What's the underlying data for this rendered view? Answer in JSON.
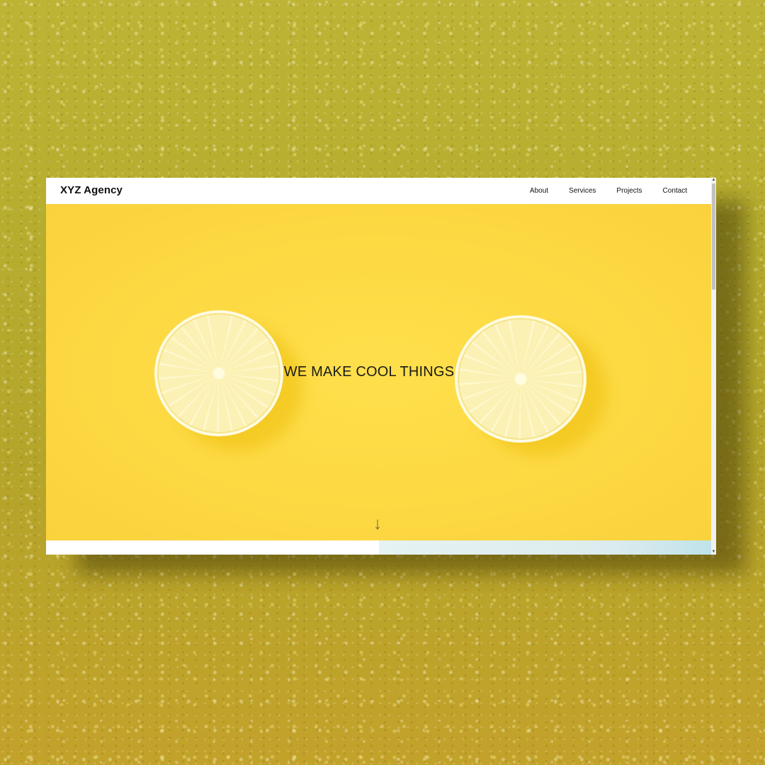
{
  "site": {
    "brand": "XYZ Agency",
    "nav": [
      {
        "label": "About"
      },
      {
        "label": "Services"
      },
      {
        "label": "Projects"
      },
      {
        "label": "Contact"
      }
    ]
  },
  "hero": {
    "title": "WE MAKE COOL THINGS",
    "scroll_hint_icon": "down-arrow-icon",
    "background_color": "#fdd942"
  },
  "scrollbar": {
    "up_icon": "▲",
    "down_icon": "▼"
  }
}
